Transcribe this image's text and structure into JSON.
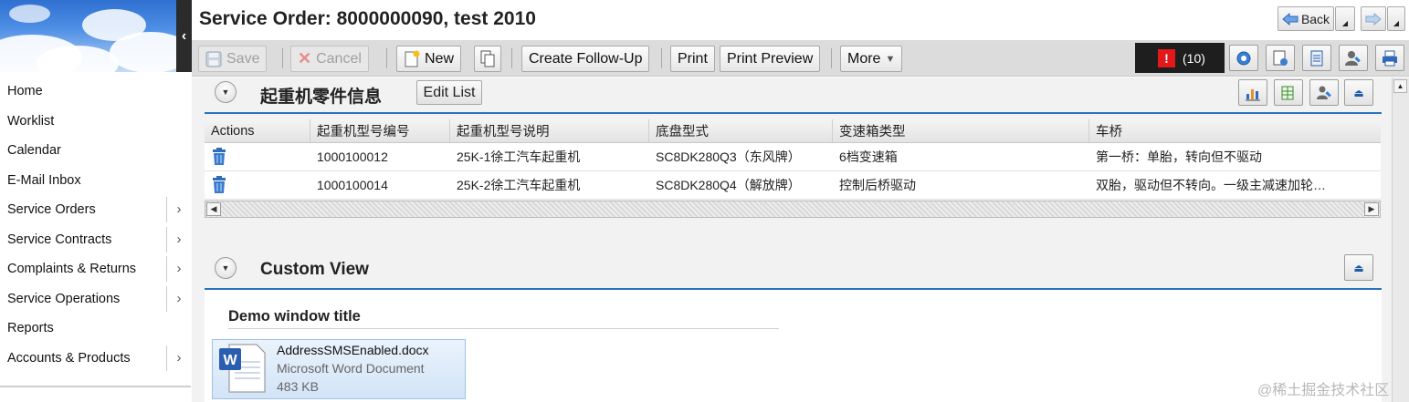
{
  "header": {
    "title": "Service Order: 8000000090, test 2010",
    "back_label": "Back"
  },
  "toolbar": {
    "save_label": "Save",
    "cancel_label": "Cancel",
    "new_label": "New",
    "create_followup_label": "Create Follow-Up",
    "print_label": "Print",
    "print_preview_label": "Print Preview",
    "more_label": "More",
    "messages_count": "(10)"
  },
  "sidebar": {
    "items": [
      {
        "label": "Home",
        "has_submenu": false
      },
      {
        "label": "Worklist",
        "has_submenu": false
      },
      {
        "label": "Calendar",
        "has_submenu": false
      },
      {
        "label": "E-Mail Inbox",
        "has_submenu": false
      },
      {
        "label": "Service Orders",
        "has_submenu": true
      },
      {
        "label": "Service Contracts",
        "has_submenu": true
      },
      {
        "label": "Complaints & Returns",
        "has_submenu": true
      },
      {
        "label": "Service Operations",
        "has_submenu": true
      },
      {
        "label": "Reports",
        "has_submenu": false
      },
      {
        "label": "Accounts & Products",
        "has_submenu": true
      }
    ]
  },
  "crane_section": {
    "title": "起重机零件信息",
    "edit_list_label": "Edit List",
    "columns": [
      "Actions",
      "起重机型号编号",
      "起重机型号说明",
      "底盘型式",
      "变速箱类型",
      "车桥"
    ],
    "rows": [
      [
        "1000100012",
        "25K-1徐工汽车起重机",
        "SC8DK280Q3（东风牌）",
        "6档变速箱",
        "第一桥：单胎，转向但不驱动"
      ],
      [
        "1000100014",
        "25K-2徐工汽车起重机",
        "SC8DK280Q4（解放牌）",
        "控制后桥驱动",
        "双胎，驱动但不转向。一级主减速加轮…"
      ]
    ]
  },
  "custom_section": {
    "title": "Custom View",
    "demo_window_title": "Demo window title",
    "attachment": {
      "file_name": "AddressSMSEnabled.docx",
      "file_type": "Microsoft Word Document",
      "file_size": "483 KB"
    }
  },
  "watermark": "@稀土掘金技术社区",
  "colors": {
    "accent_blue": "#2a73c2",
    "toolbar_bg": "#dcdcdc",
    "error_red": "#e3181a"
  }
}
